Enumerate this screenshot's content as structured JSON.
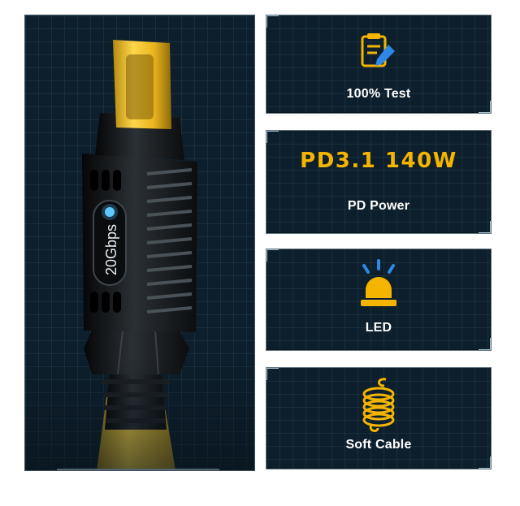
{
  "product": {
    "speed_label": "20Gbps",
    "colors": {
      "accent": "#f4b400",
      "background": "#0d1f2c",
      "cable": "#d6b434",
      "housing": "#161a1d"
    }
  },
  "cards": [
    {
      "label": "100% Test",
      "icon": "checklist-pencil-icon"
    },
    {
      "headline": "PD3.1 140W",
      "label": "PD Power",
      "icon": "none"
    },
    {
      "label": "LED",
      "icon": "warning-light-icon"
    },
    {
      "label": "Soft Cable",
      "icon": "coiled-cable-icon"
    }
  ]
}
